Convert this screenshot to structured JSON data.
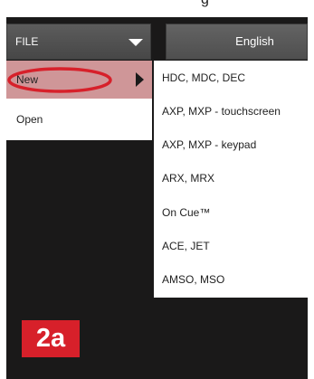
{
  "header": {
    "partial_text": "g"
  },
  "file_dropdown": {
    "label": "FILE",
    "caret_icon": "caret-down-icon"
  },
  "language_button": {
    "label": "English"
  },
  "file_menu": {
    "items": [
      {
        "label": "New",
        "icon": "submenu-arrow-right-icon",
        "highlighted": true
      },
      {
        "label": "Open"
      }
    ]
  },
  "submenu": {
    "items": [
      {
        "label": "HDC, MDC, DEC"
      },
      {
        "label": "AXP, MXP - touchscreen"
      },
      {
        "label": "AXP, MXP - keypad"
      },
      {
        "label": "ARX, MRX"
      },
      {
        "label": "On Cue™"
      },
      {
        "label": "ACE, JET"
      },
      {
        "label": "AMSO, MSO"
      }
    ]
  },
  "annotation": {
    "label": "2a",
    "ring_color": "#d7202a",
    "badge_color": "#d7202a"
  },
  "colors": {
    "menu_highlight": "#cf9698",
    "background": "#1a1919",
    "dropdown": "#4f4f4f"
  }
}
